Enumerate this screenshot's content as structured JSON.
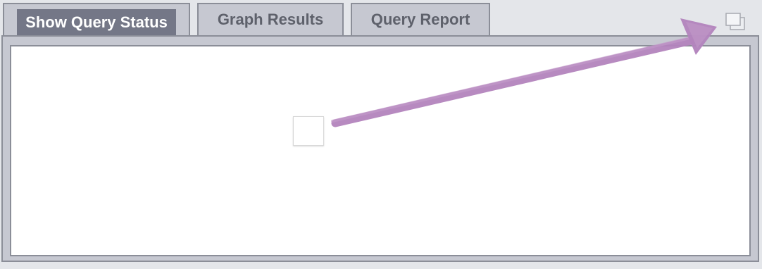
{
  "tabs": {
    "show_query_status": "Show Query Status",
    "graph_results": "Graph Results",
    "query_report": "Query Report"
  },
  "icons": {
    "popout": "popout-window-icon",
    "arrow": "annotation-arrow"
  },
  "colors": {
    "active_tab": "#747787",
    "tab_bg": "#c6c8d1",
    "annotation_arrow": "#b07fb8"
  }
}
